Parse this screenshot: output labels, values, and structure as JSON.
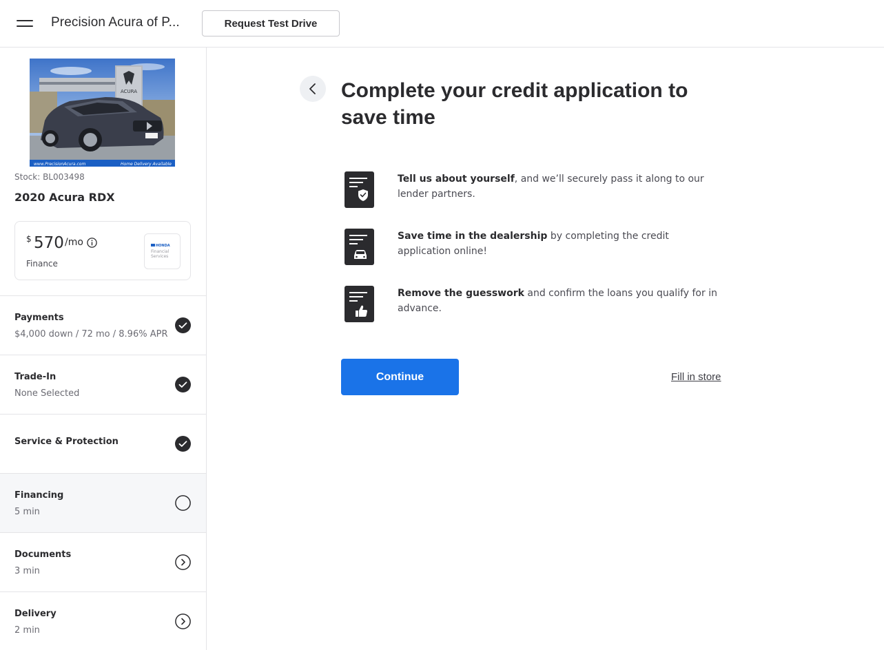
{
  "header": {
    "dealer_name": "Precision Acura of P...",
    "test_drive_label": "Request Test Drive"
  },
  "vehicle": {
    "photo_caption_left": "www.PrecisionAcura.com",
    "photo_caption_right": "Home Delivery Available",
    "photo_sign": "ACURA",
    "stock": "Stock: BL003498",
    "model": "2020 Acura RDX",
    "price_currency": "$",
    "price_amount": "570",
    "price_period": "/mo",
    "price_type": "Finance",
    "lender_name": "HONDA",
    "lender_sub": "Financial Services"
  },
  "steps": [
    {
      "title": "Payments",
      "subtitle": "$4,000 down / 72 mo / 8.96% APR",
      "status": "complete"
    },
    {
      "title": "Trade-In",
      "subtitle": "None Selected",
      "status": "complete"
    },
    {
      "title": "Service & Protection",
      "subtitle": "",
      "status": "complete"
    },
    {
      "title": "Financing",
      "subtitle": "5 min",
      "status": "current"
    },
    {
      "title": "Documents",
      "subtitle": "3 min",
      "status": "upcoming"
    },
    {
      "title": "Delivery",
      "subtitle": "2 min",
      "status": "upcoming"
    }
  ],
  "main": {
    "heading": "Complete your credit application to save time",
    "benefits": [
      {
        "bold": "Tell us about yourself",
        "text": ", and we’ll securely pass it along to our lender partners.",
        "icon": "shield-document-icon"
      },
      {
        "bold": "Save time in the dealership",
        "text": " by completing the credit application online!",
        "icon": "car-document-icon"
      },
      {
        "bold": "Remove the guesswork",
        "text": " and confirm the loans you qualify for in advance.",
        "icon": "thumbs-up-document-icon"
      }
    ],
    "continue_label": "Continue",
    "fill_store_label": "Fill in store"
  },
  "colors": {
    "accent": "#1a73e8",
    "dark": "#2b2b2e",
    "active_row": "#f6f7f9"
  }
}
